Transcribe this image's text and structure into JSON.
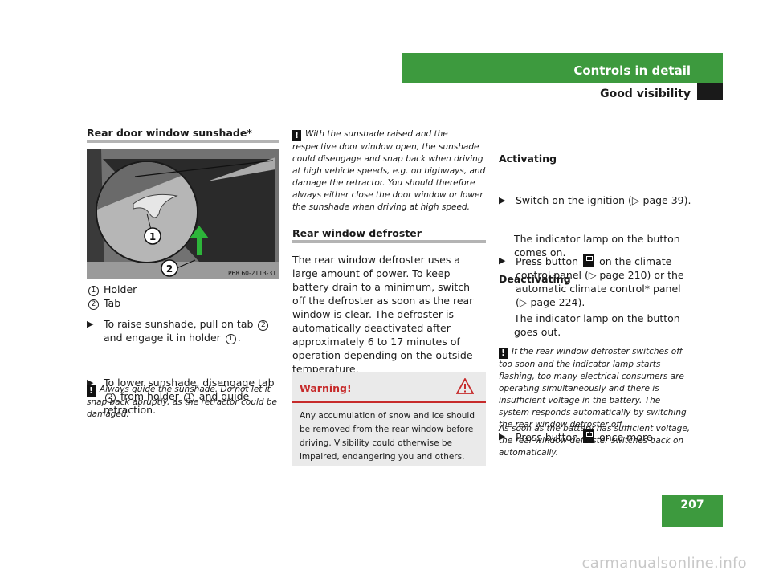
{
  "header": {
    "section": "Controls in detail",
    "subsection": "Good visibility"
  },
  "page_number": "207",
  "watermark": "carmanualsonline.info",
  "col1": {
    "title": "Rear door window sunshade*",
    "figure": {
      "callout1": "1",
      "callout2": "2",
      "code": "P68.60-2113-31"
    },
    "legend": [
      {
        "num": "1",
        "label": "Holder"
      },
      {
        "num": "2",
        "label": "Tab"
      }
    ],
    "steps": [
      {
        "parts": [
          "To raise sunshade, pull on tab ",
          "2",
          " and engage it in holder ",
          "1",
          "."
        ]
      },
      {
        "parts": [
          "To lower sunshade, disengage tab ",
          "2",
          " from holder ",
          "1",
          " and guide retraction."
        ]
      }
    ],
    "note": "Always guide the sunshade. Do not let it snap back abruptly, as the retractor could be damaged."
  },
  "col2": {
    "note": "With the sunshade raised and the respective door window open, the sunshade could disengage and snap back when driving at high vehicle speeds, e.g. on highways, and damage the retractor. You should therefore always either close the door window or lower the sunshade when driving at high speed.",
    "title": "Rear window defroster",
    "body": "The rear window defroster uses a large amount of power. To keep battery drain to a minimum, switch off the defroster as soon as the rear window is clear. The defroster is automatically deactivated after approximately 6 to 17 minutes of operation depending on the outside temperature.",
    "warning": {
      "title": "Warning!",
      "text": "Any accumulation of snow and ice should be removed from the rear window before driving. Visibility could otherwise be impaired, endangering you and others."
    }
  },
  "col3": {
    "step_ignition": "Switch on the ignition (▷ page 39).",
    "activating_title": "Activating",
    "activating_step_a": "Press button",
    "activating_step_b": "on the climate control panel (▷ page 210) or the automatic climate control* panel (▷ page 224).",
    "activating_result": "The indicator lamp on the button comes on.",
    "deactivating_title": "Deactivating",
    "deactivating_step_a": "Press button",
    "deactivating_step_b": "once more.",
    "deactivating_result": "The indicator lamp on the button goes out.",
    "note1": "If the rear window defroster switches off too soon and the indicator lamp starts flashing, too many electrical consumers are operating simultaneously and there is insufficient voltage in the battery. The system responds automatically by switching the rear window defroster off.",
    "note2": "As soon as the battery has sufficient voltage, the rear window defroster switches back on automatically."
  }
}
